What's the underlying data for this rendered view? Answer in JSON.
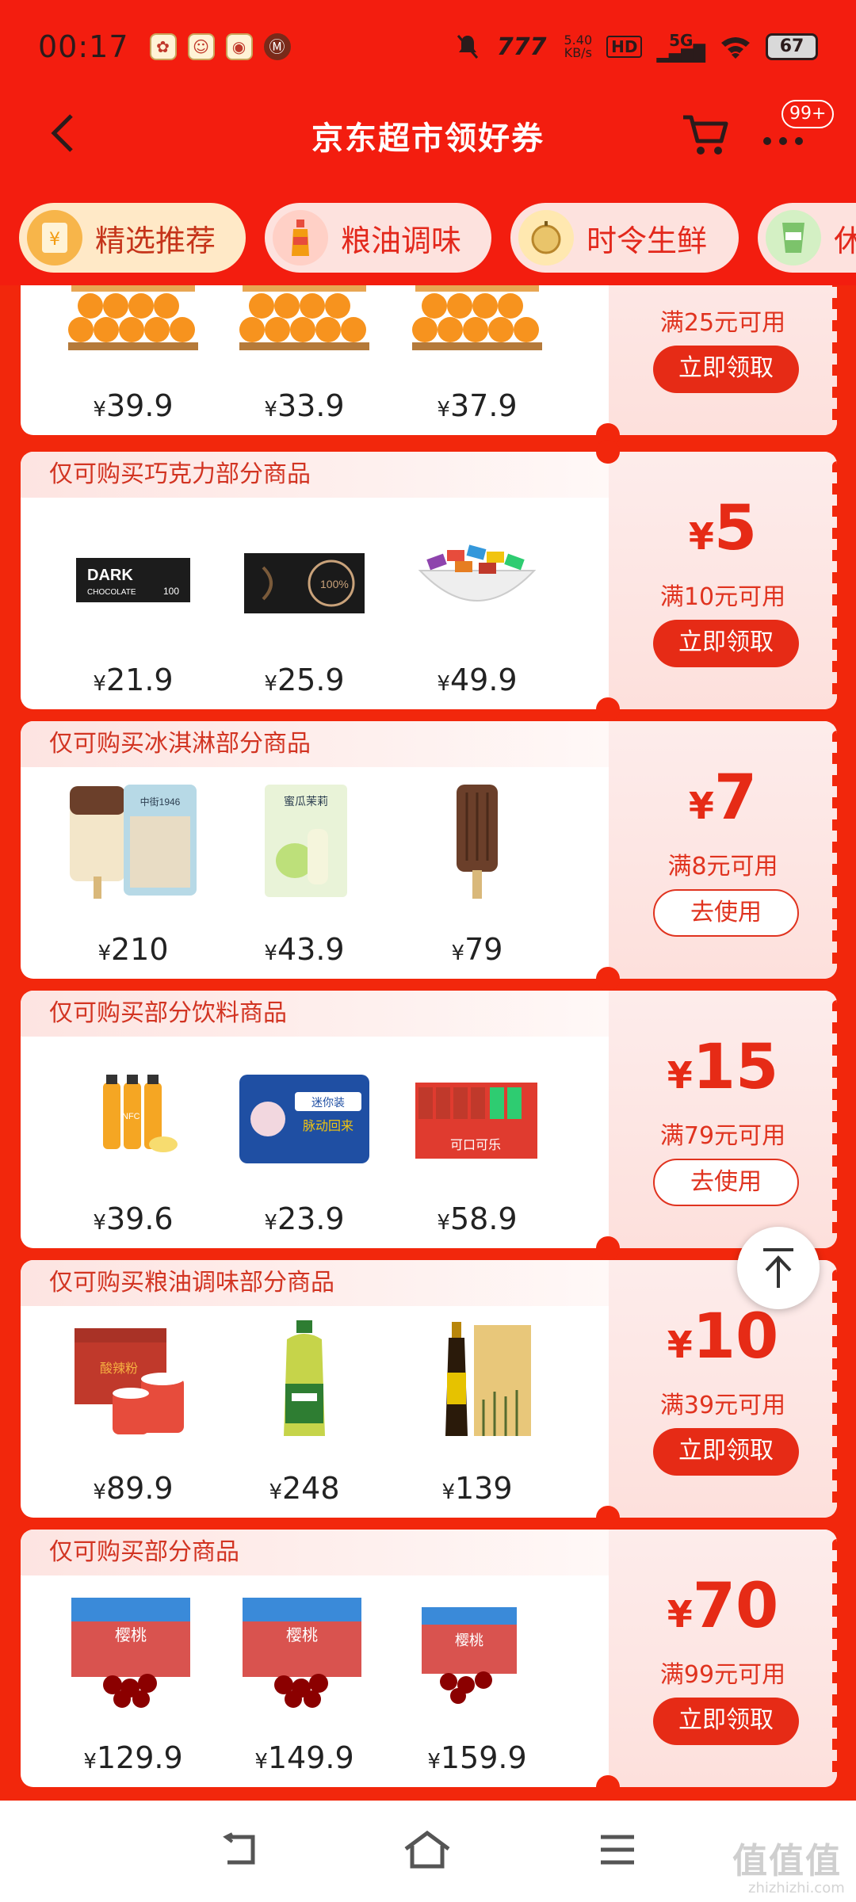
{
  "status_bar": {
    "time": "00:17",
    "network_speed": "5.40",
    "network_unit": "KB/s",
    "hd": "HD",
    "signal": "5G",
    "battery": "67",
    "carrier_logo": "777"
  },
  "header": {
    "title": "京东超市领好券",
    "more_badge": "99+"
  },
  "tabs": [
    {
      "label": "精选推荐",
      "icon": "coupon-icon",
      "active": true
    },
    {
      "label": "粮油调味",
      "icon": "sauce-bottle-icon",
      "active": false
    },
    {
      "label": "时令生鲜",
      "icon": "durian-icon",
      "active": false
    },
    {
      "label": "休",
      "icon": "snack-icon",
      "active": false
    }
  ],
  "coupons": [
    {
      "scope": "",
      "products": [
        {
          "price": "39.9"
        },
        {
          "price": "33.9"
        },
        {
          "price": "37.9"
        }
      ],
      "amount": "",
      "condition": "满25元可用",
      "button": "立即领取",
      "button_style": "fill"
    },
    {
      "scope": "仅可购买巧克力部分商品",
      "products": [
        {
          "price": "21.9"
        },
        {
          "price": "25.9"
        },
        {
          "price": "49.9"
        }
      ],
      "amount": "5",
      "condition": "满10元可用",
      "button": "立即领取",
      "button_style": "fill"
    },
    {
      "scope": "仅可购买冰淇淋部分商品",
      "products": [
        {
          "price": "210"
        },
        {
          "price": "43.9"
        },
        {
          "price": "79"
        }
      ],
      "amount": "7",
      "condition": "满8元可用",
      "button": "去使用",
      "button_style": "outline"
    },
    {
      "scope": "仅可购买部分饮料商品",
      "products": [
        {
          "price": "39.6"
        },
        {
          "price": "23.9"
        },
        {
          "price": "58.9"
        }
      ],
      "amount": "15",
      "condition": "满79元可用",
      "button": "去使用",
      "button_style": "outline"
    },
    {
      "scope": "仅可购买粮油调味部分商品",
      "products": [
        {
          "price": "89.9"
        },
        {
          "price": "248"
        },
        {
          "price": "139"
        }
      ],
      "amount": "10",
      "condition": "满39元可用",
      "button": "立即领取",
      "button_style": "fill"
    },
    {
      "scope": "仅可购买部分商品",
      "products": [
        {
          "price": "129.9"
        },
        {
          "price": "149.9"
        },
        {
          "price": "159.9"
        }
      ],
      "amount": "70",
      "condition": "满99元可用",
      "button": "立即领取",
      "button_style": "fill"
    }
  ],
  "product_labels": {
    "chocolate_1": "DARK CHOCOLATE",
    "chocolate_2": "100%",
    "icecream_1": "中街1946",
    "icecream_2": "蜜瓜茉莉",
    "drink_1": "NFC",
    "drink_2": "迷你装 脉动回来",
    "drink_3": "可口可乐",
    "cherry": "樱桃"
  },
  "currency": "¥",
  "watermark": {
    "main": "值值值",
    "sub": "zhizhizhi.com"
  },
  "colors": {
    "brand_red": "#f2270c",
    "coupon_red": "#e62b16"
  }
}
